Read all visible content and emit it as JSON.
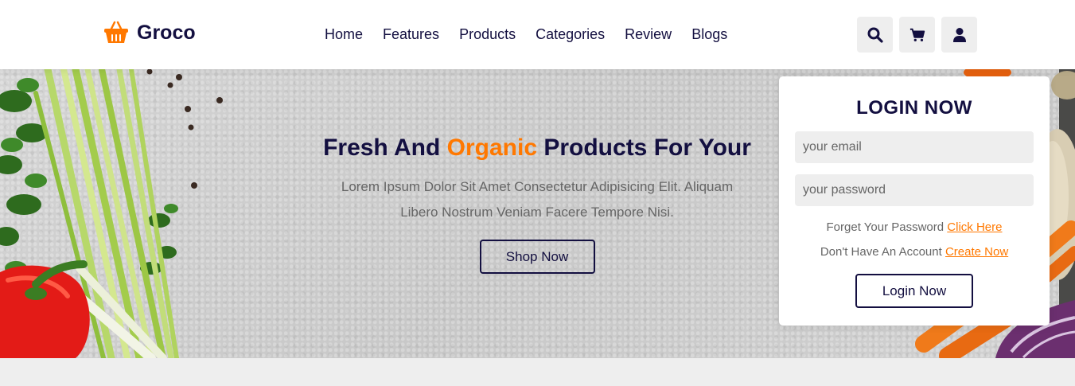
{
  "brand": {
    "name": "Groco",
    "accent": "#ff7800",
    "primary": "#130f40"
  },
  "nav": {
    "items": [
      "Home",
      "Features",
      "Products",
      "Categories",
      "Review",
      "Blogs"
    ]
  },
  "header_icons": [
    "search-icon",
    "cart-icon",
    "user-icon"
  ],
  "hero": {
    "title_part1": "Fresh And ",
    "title_accent": "Organic",
    "title_part2": " Products For Your",
    "description": "Lorem Ipsum Dolor Sit Amet Consectetur Adipisicing Elit. Aliquam Libero Nostrum Veniam Facere Tempore Nisi.",
    "cta_label": "Shop Now"
  },
  "login": {
    "title": "LOGIN NOW",
    "email_placeholder": "your email",
    "password_placeholder": "your password",
    "forgot_text": "Forget Your Password ",
    "forgot_link": "Click Here",
    "signup_text": "Don't Have An Account ",
    "signup_link": "Create Now",
    "submit_label": "Login Now"
  }
}
